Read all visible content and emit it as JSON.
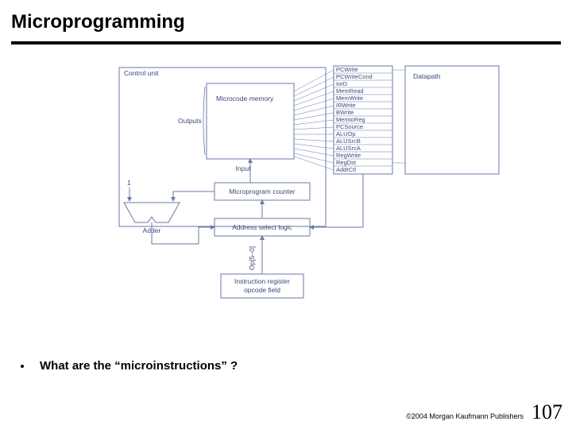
{
  "title": "Microprogramming",
  "bullet": "What are the “microinstructions” ?",
  "copyright": "©2004 Morgan Kaufmann Publishers",
  "page": "107",
  "diagram": {
    "control_unit": "Control unit",
    "microcode_memory": "Microcode memory",
    "outputs": "Outputs",
    "datapath": "Datapath",
    "input": "Input",
    "one": "1",
    "adder": "Adder",
    "microprogram_counter": "Microprogram counter",
    "address_select_logic": "Address select logic",
    "op_field": "Op[5–0]",
    "instr_reg_1": "Instruction register",
    "instr_reg_2": "opcode field",
    "signals": [
      "PCWrite",
      "PCWriteCond",
      "IorD",
      "MemRead",
      "MemWrite",
      "IRWrite",
      "BWrite",
      "MemtoReg",
      "PCSource",
      "ALUOp",
      "ALUSrcB",
      "ALUSrcA",
      "RegWrite",
      "RegDst",
      "AddrCtl"
    ]
  }
}
